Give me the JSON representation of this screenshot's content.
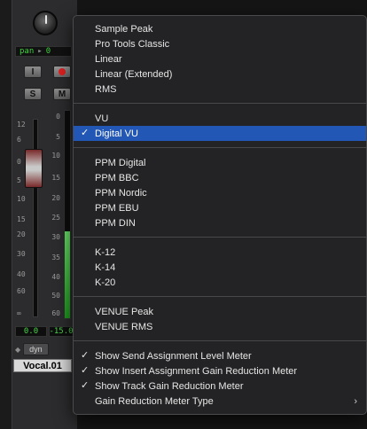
{
  "strip": {
    "pan_label": "pan",
    "pan_arrow": "▸",
    "pan_value": "0",
    "input_button": "I",
    "solo_button": "S",
    "mute_button": "M",
    "fader_scale": [
      "12",
      "6",
      "0",
      "5",
      "10",
      "15",
      "20",
      "30",
      "40",
      "60",
      "∞"
    ],
    "meter_scale": [
      "0",
      "5",
      "10",
      "15",
      "20",
      "25",
      "30",
      "35",
      "40",
      "50",
      "60"
    ],
    "volume_readout": "0.0",
    "peak_readout": "-15.0",
    "dyn_label": "dyn",
    "track_name": "Vocal.01",
    "meter_level": 0.42,
    "colors": {
      "meter_green": "#3fd13f",
      "record_red": "#e02020",
      "selection_blue": "#2357b6"
    }
  },
  "menu": {
    "groups": [
      [
        "Sample Peak",
        "Pro Tools Classic",
        "Linear",
        "Linear (Extended)",
        "RMS"
      ],
      [
        "VU",
        "Digital VU"
      ],
      [
        "PPM Digital",
        "PPM BBC",
        "PPM Nordic",
        "PPM EBU",
        "PPM DIN"
      ],
      [
        "K-12",
        "K-14",
        "K-20"
      ],
      [
        "VENUE Peak",
        "VENUE RMS"
      ],
      [
        "Show Send Assignment Level Meter",
        "Show Insert Assignment Gain Reduction Meter",
        "Show Track Gain Reduction Meter",
        "Gain Reduction Meter Type"
      ]
    ],
    "selected": "Digital VU",
    "checked": [
      "Digital VU",
      "Show Send Assignment Level Meter",
      "Show Insert Assignment Gain Reduction Meter",
      "Show Track Gain Reduction Meter"
    ],
    "submenu": [
      "Gain Reduction Meter Type"
    ],
    "check_glyph": "✓",
    "submenu_glyph": "›"
  }
}
